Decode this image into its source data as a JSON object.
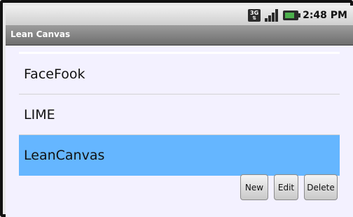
{
  "status_bar": {
    "network_label": "3G",
    "time": "2:48",
    "time_suffix": "PM",
    "icons": [
      "network-3g-icon",
      "signal-strength-icon",
      "battery-charging-icon"
    ]
  },
  "app": {
    "title": "Lean Canvas"
  },
  "list": {
    "items": [
      {
        "label": "FaceFook",
        "selected": false
      },
      {
        "label": "LIME",
        "selected": false
      },
      {
        "label": "LeanCanvas",
        "selected": true
      }
    ]
  },
  "buttons": {
    "new_label": "New",
    "edit_label": "Edit",
    "delete_label": "Delete"
  },
  "colors": {
    "selection": "#65b6ff",
    "background": "#f3f1ff",
    "titlebar": "#7d7d7d"
  }
}
